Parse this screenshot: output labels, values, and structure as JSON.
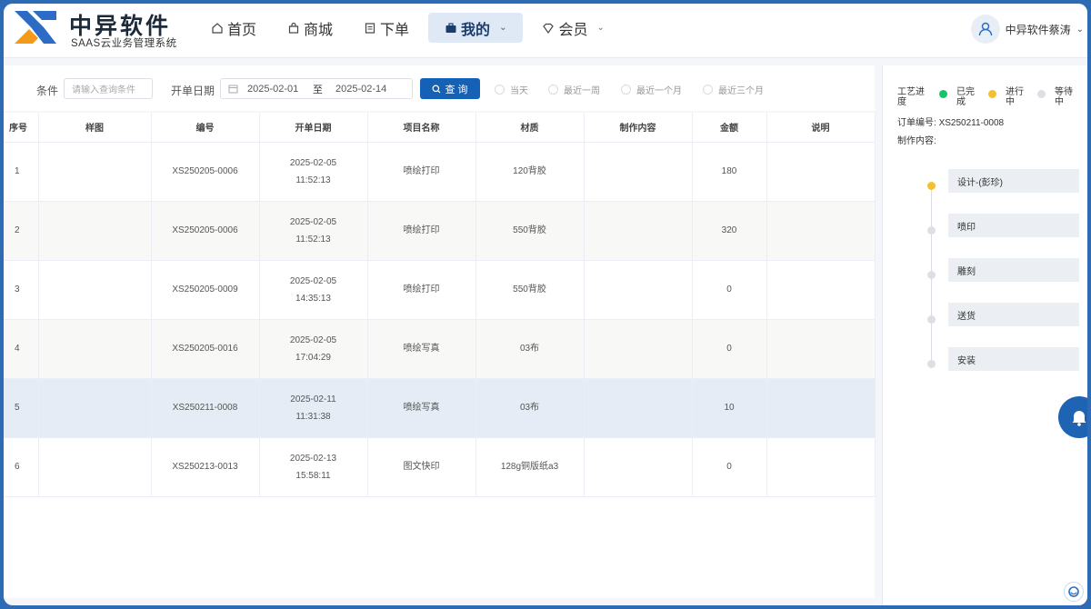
{
  "brand": {
    "name": "中异软件",
    "subtitle": "SAAS云业务管理系统",
    "accent": "#1561b5",
    "logo_blue": "#2c6cc7",
    "logo_orange": "#f39a1b"
  },
  "nav": {
    "items": [
      {
        "label": "首页",
        "icon": "home-icon"
      },
      {
        "label": "商城",
        "icon": "shop-bag-icon"
      },
      {
        "label": "下单",
        "icon": "order-form-icon"
      },
      {
        "label": "我的",
        "icon": "briefcase-icon",
        "active": true
      },
      {
        "label": "会员",
        "icon": "diamond-icon"
      }
    ]
  },
  "user": {
    "name": "中异软件蔡涛"
  },
  "filter": {
    "condition_label": "条件",
    "condition_placeholder": "请输入查询条件",
    "date_label": "开单日期",
    "date_start": "2025-02-01",
    "date_sep": "至",
    "date_end": "2025-02-14",
    "query_label": "查 询",
    "ranges": [
      "当天",
      "最近一周",
      "最近一个月",
      "最近三个月"
    ]
  },
  "table": {
    "columns": [
      "序号",
      "样图",
      "编号",
      "开单日期",
      "项目名称",
      "材质",
      "制作内容",
      "金额",
      "说明"
    ],
    "rows": [
      {
        "idx": "1",
        "sample": "",
        "code": "XS250205-0006",
        "date": "2025-02-05",
        "time": "11:52:13",
        "project": "喷绘打印",
        "material": "120背胶",
        "content": "",
        "amount": "180",
        "note": ""
      },
      {
        "idx": "2",
        "sample": "",
        "code": "XS250205-0006",
        "date": "2025-02-05",
        "time": "11:52:13",
        "project": "喷绘打印",
        "material": "550背胶",
        "content": "",
        "amount": "320",
        "note": ""
      },
      {
        "idx": "3",
        "sample": "",
        "code": "XS250205-0009",
        "date": "2025-02-05",
        "time": "14:35:13",
        "project": "喷绘打印",
        "material": "550背胶",
        "content": "",
        "amount": "0",
        "note": ""
      },
      {
        "idx": "4",
        "sample": "",
        "code": "XS250205-0016",
        "date": "2025-02-05",
        "time": "17:04:29",
        "project": "喷绘写真",
        "material": "03布",
        "content": "",
        "amount": "0",
        "note": ""
      },
      {
        "idx": "5",
        "sample": "",
        "code": "XS250211-0008",
        "date": "2025-02-11",
        "time": "11:31:38",
        "project": "喷绘写真",
        "material": "03布",
        "content": "",
        "amount": "10",
        "note": "",
        "selected": true
      },
      {
        "idx": "6",
        "sample": "",
        "code": "XS250213-0013",
        "date": "2025-02-13",
        "time": "15:58:11",
        "project": "图文快印",
        "material": "128g铜版纸a3",
        "content": "",
        "amount": "0",
        "note": ""
      }
    ]
  },
  "side": {
    "progress_label": "工艺进度",
    "legend": [
      {
        "label": "已完成",
        "color": "#19c26b"
      },
      {
        "label": "进行中",
        "color": "#f5c02d"
      },
      {
        "label": "等待中",
        "color": "#dcdfe4"
      }
    ],
    "order_no_label": "订单编号:",
    "order_no": "XS250211-0008",
    "content_label": "制作内容:",
    "steps": [
      {
        "label": "设计-(彭珍)",
        "status": "in-progress"
      },
      {
        "label": "喷印",
        "status": "waiting"
      },
      {
        "label": "雕刻",
        "status": "waiting"
      },
      {
        "label": "送货",
        "status": "waiting"
      },
      {
        "label": "安装",
        "status": "waiting"
      }
    ]
  }
}
